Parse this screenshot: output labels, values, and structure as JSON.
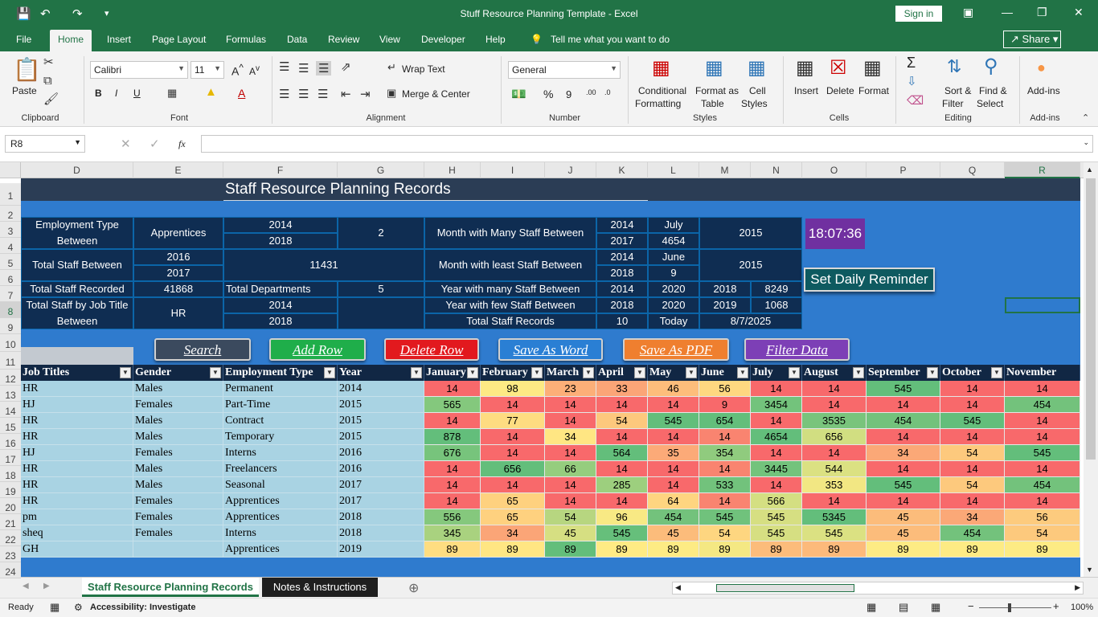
{
  "window": {
    "title": "Stuff Resource Planning Template  -  Excel",
    "signin": "Sign in"
  },
  "tabs": [
    "File",
    "Home",
    "Insert",
    "Page Layout",
    "Formulas",
    "Data",
    "Review",
    "View",
    "Developer",
    "Help"
  ],
  "tell_me": "Tell me what you want to do",
  "share": "Share",
  "ribbon": {
    "paste": "Paste",
    "font_name": "Calibri",
    "font_size": "11",
    "wrap_text": "Wrap Text",
    "merge_center": "Merge & Center",
    "number_format": "General",
    "conditional_formatting": [
      "Conditional",
      "Formatting"
    ],
    "format_as_table": [
      "Format as",
      "Table"
    ],
    "cell_styles": [
      "Cell",
      "Styles"
    ],
    "insert": "Insert",
    "delete": "Delete",
    "format": "Format",
    "sort_filter": [
      "Sort &",
      "Filter"
    ],
    "find_select": [
      "Find &",
      "Select"
    ],
    "addins": "Add-ins",
    "groups": [
      "Clipboard",
      "Font",
      "Alignment",
      "Number",
      "Styles",
      "Cells",
      "Editing",
      "Add-ins"
    ]
  },
  "formula_bar": {
    "name_box": "R8",
    "fx": "fx",
    "formula": ""
  },
  "columns": [
    "D",
    "E",
    "F",
    "G",
    "H",
    "I",
    "J",
    "K",
    "L",
    "M",
    "N",
    "O",
    "P",
    "Q",
    "R"
  ],
  "rows": [
    "1",
    "2",
    "3",
    "4",
    "5",
    "6",
    "7",
    "8",
    "9",
    "10",
    "11",
    "12",
    "13",
    "14",
    "15",
    "16",
    "17",
    "18",
    "19",
    "20",
    "21",
    "22",
    "23",
    "24"
  ],
  "sheet_title": "Staff Resource Planning Records",
  "clock": "18:07:36",
  "reminder_button": "Set Daily Reminder",
  "summary": {
    "emp_type_label": "Employment Type Between",
    "emp_type_value": "Apprentices",
    "emp_year1": "2014",
    "emp_year2": "2018",
    "emp_count": "2",
    "month_many_label": "Month with Many Staff Between",
    "mm_y1": "2014",
    "mm_y2": "2017",
    "mm_month": "July",
    "mm_count": "4654",
    "mm_year": "2015",
    "total_between_label": "Total Staff Between",
    "tb_y1": "2016",
    "tb_y2": "2017",
    "tb_count": "11431",
    "month_least_label": "Month with least Staff Between",
    "ml_y1": "2014",
    "ml_y2": "2018",
    "ml_month": "June",
    "ml_count": "9",
    "ml_year": "2015",
    "total_recorded_label": "Total Staff Recorded",
    "total_recorded": "41868",
    "total_depts_label": "Total Departments",
    "total_depts": "5",
    "year_many_label": "Year with many Staff Between",
    "ym_y1": "2014",
    "ym_y2": "2020",
    "ym_year": "2018",
    "ym_count": "8249",
    "year_few_label": "Year with few  Staff Between",
    "yf_y1": "2018",
    "yf_y2": "2020",
    "yf_year": "2019",
    "yf_count": "1068",
    "job_title_label": "Total Staff by Job Title Between",
    "jt_value": "HR",
    "jt_y1": "2014",
    "jt_y2": "2018",
    "total_records_label": "Total Staff Records",
    "total_records": "10",
    "today_label": "Today",
    "today": "8/7/2025"
  },
  "buttons": {
    "search": "Search",
    "add_row": "Add Row",
    "delete_row": "Delete Row",
    "save_word": "Save As Word",
    "save_pdf": "Save As PDF",
    "filter": "Filter Data"
  },
  "table": {
    "headers": [
      "Job Titles",
      "Gender",
      "Employment Type",
      "Year",
      "January",
      "February",
      "March",
      "April",
      "May",
      "June",
      "July",
      "August",
      "September",
      "October",
      "November"
    ],
    "rows": [
      [
        "HR",
        "Males",
        "Permanent",
        "2014",
        "14",
        "98",
        "23",
        "33",
        "46",
        "56",
        "14",
        "14",
        "545",
        "14",
        "14"
      ],
      [
        "HJ",
        "Females",
        "Part-Time",
        "2015",
        "565",
        "14",
        "14",
        "14",
        "14",
        "9",
        "3454",
        "14",
        "14",
        "14",
        "454"
      ],
      [
        "HR",
        "Males",
        "Contract",
        "2015",
        "14",
        "77",
        "14",
        "54",
        "545",
        "654",
        "14",
        "3535",
        "454",
        "545",
        "14"
      ],
      [
        "HR",
        "Males",
        "Temporary",
        "2015",
        "878",
        "14",
        "34",
        "14",
        "14",
        "14",
        "4654",
        "656",
        "14",
        "14",
        "14"
      ],
      [
        "HJ",
        "Females",
        "Interns",
        "2016",
        "676",
        "14",
        "14",
        "564",
        "35",
        "354",
        "14",
        "14",
        "34",
        "54",
        "545"
      ],
      [
        "HR",
        "Males",
        "Freelancers",
        "2016",
        "14",
        "656",
        "66",
        "14",
        "14",
        "14",
        "3445",
        "544",
        "14",
        "14",
        "14"
      ],
      [
        "HR",
        "Males",
        "Seasonal",
        "2017",
        "14",
        "14",
        "14",
        "285",
        "14",
        "533",
        "14",
        "353",
        "545",
        "54",
        "454"
      ],
      [
        "HR",
        "Females",
        "Apprentices",
        "2017",
        "14",
        "65",
        "14",
        "14",
        "64",
        "14",
        "566",
        "14",
        "14",
        "14",
        "14"
      ],
      [
        "pm",
        "Females",
        "Apprentices",
        "2018",
        "556",
        "65",
        "54",
        "96",
        "454",
        "545",
        "545",
        "5345",
        "45",
        "34",
        "56"
      ],
      [
        "sheq",
        "Females",
        "Interns",
        "2018",
        "345",
        "34",
        "45",
        "545",
        "45",
        "54",
        "545",
        "545",
        "45",
        "454",
        "54"
      ],
      [
        "GH",
        "",
        "Apprentices",
        "2019",
        "89",
        "89",
        "89",
        "89",
        "89",
        "89",
        "89",
        "89",
        "89",
        "89",
        "89"
      ]
    ]
  },
  "sheet_tabs": [
    "Staff Resource Planning Records",
    "Notes & Instructions"
  ],
  "status": {
    "ready": "Ready",
    "accessibility": "Accessibility: Investigate",
    "zoom": "100%"
  },
  "colors": {
    "excel_green": "#217346",
    "grid_blue": "#2f7bce",
    "navy": "#0f2d52",
    "red": "#f8696b",
    "yellow": "#ffeb84",
    "green": "#63be7b"
  }
}
